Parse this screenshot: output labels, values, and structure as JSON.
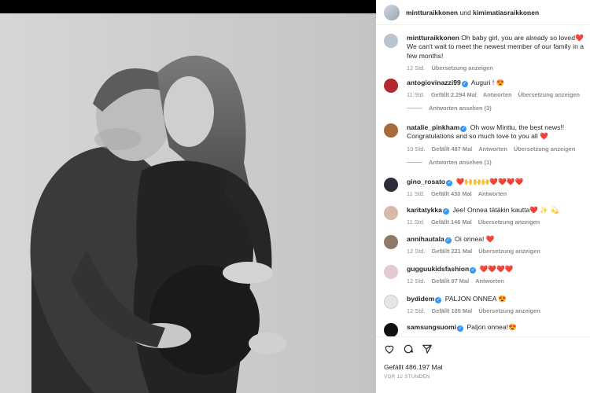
{
  "post": {
    "authors": {
      "a": "mintturaikkonen",
      "joiner": "und",
      "b": "kimimatiasraikkonen"
    },
    "likes_label": "Gefällt 486.197 Mal",
    "posted": "VOR 12 STUNDEN"
  },
  "comments": [
    {
      "user": "mintturaikkonen",
      "verified": false,
      "text": "Oh baby girl, you are already so loved",
      "emoji_end": "❤️",
      "text2": " We can't wait to meet the newest member of our family in a few months!",
      "time": "12 Std.",
      "likes": "",
      "actions": [
        "Übersetzung anzeigen"
      ],
      "avatar_color": "#b7c3cf",
      "replies": ""
    },
    {
      "user": "antogiovinazzi99",
      "verified": true,
      "text": "Auguri ! ",
      "emoji_end": "😍",
      "text2": "",
      "time": "11 Std.",
      "likes": "Gefällt 2.294 Mal",
      "actions": [
        "Antworten",
        "Übersetzung anzeigen"
      ],
      "avatar_color": "#b02a30",
      "replies": "Antworten ansehen (3)"
    },
    {
      "user": "natalie_pinkham",
      "verified": true,
      "text": "Oh wow Minttu, the best news!! Congratulations and so much love to you all ",
      "emoji_end": "❤️",
      "text2": "",
      "time": "10 Std.",
      "likes": "Gefällt 487 Mal",
      "actions": [
        "Antworten",
        "Übersetzung anzeigen"
      ],
      "avatar_color": "#a86a3c",
      "replies": "Antworten ansehen (1)"
    },
    {
      "user": "gino_rosato",
      "verified": true,
      "text": "❤️🙌🙌🙌❤️❤️❤️❤️",
      "emoji_end": "",
      "text2": "",
      "time": "11 Std.",
      "likes": "Gefällt 430 Mal",
      "actions": [
        "Antworten"
      ],
      "avatar_color": "#2c2c3a",
      "replies": ""
    },
    {
      "user": "karitatykka",
      "verified": true,
      "text": "Jee! Onnea tätäkin kautta",
      "emoji_end": "❤️ ✨ 💫",
      "text2": "",
      "time": "11 Std.",
      "likes": "Gefällt 146 Mal",
      "actions": [
        "Übersetzung anzeigen"
      ],
      "avatar_color": "#d8b8a8",
      "replies": ""
    },
    {
      "user": "annihautala",
      "verified": true,
      "text": "Oi onnea! ",
      "emoji_end": "❤️",
      "text2": "",
      "time": "12 Std.",
      "likes": "Gefällt 221 Mal",
      "actions": [
        "Übersetzung anzeigen"
      ],
      "avatar_color": "#8e7a68",
      "replies": ""
    },
    {
      "user": "gugguukidsfashion",
      "verified": true,
      "text": "❤️❤️❤️❤️",
      "emoji_end": "",
      "text2": "",
      "time": "12 Std.",
      "likes": "Gefällt 97 Mal",
      "actions": [
        "Antworten"
      ],
      "avatar_color": "#e4c9cf",
      "replies": ""
    },
    {
      "user": "bydidem",
      "verified": true,
      "text": "PALJON ONNEA ",
      "emoji_end": "😍",
      "text2": "",
      "time": "12 Std.",
      "likes": "Gefällt 105 Mal",
      "actions": [
        "Übersetzung anzeigen"
      ],
      "avatar_color": "#e6e6e6",
      "replies": ""
    },
    {
      "user": "samsungsuomi",
      "verified": true,
      "text": "Paljon onnea!",
      "emoji_end": "😍",
      "text2": "",
      "time": "",
      "likes": "",
      "actions": [],
      "avatar_color": "#111111",
      "replies": ""
    }
  ],
  "icons": [
    "heart-icon",
    "comment-icon",
    "share-icon"
  ],
  "colors": {
    "accent": "#3897f0",
    "heart": "#e0245e",
    "muted": "#8e8e8e"
  }
}
